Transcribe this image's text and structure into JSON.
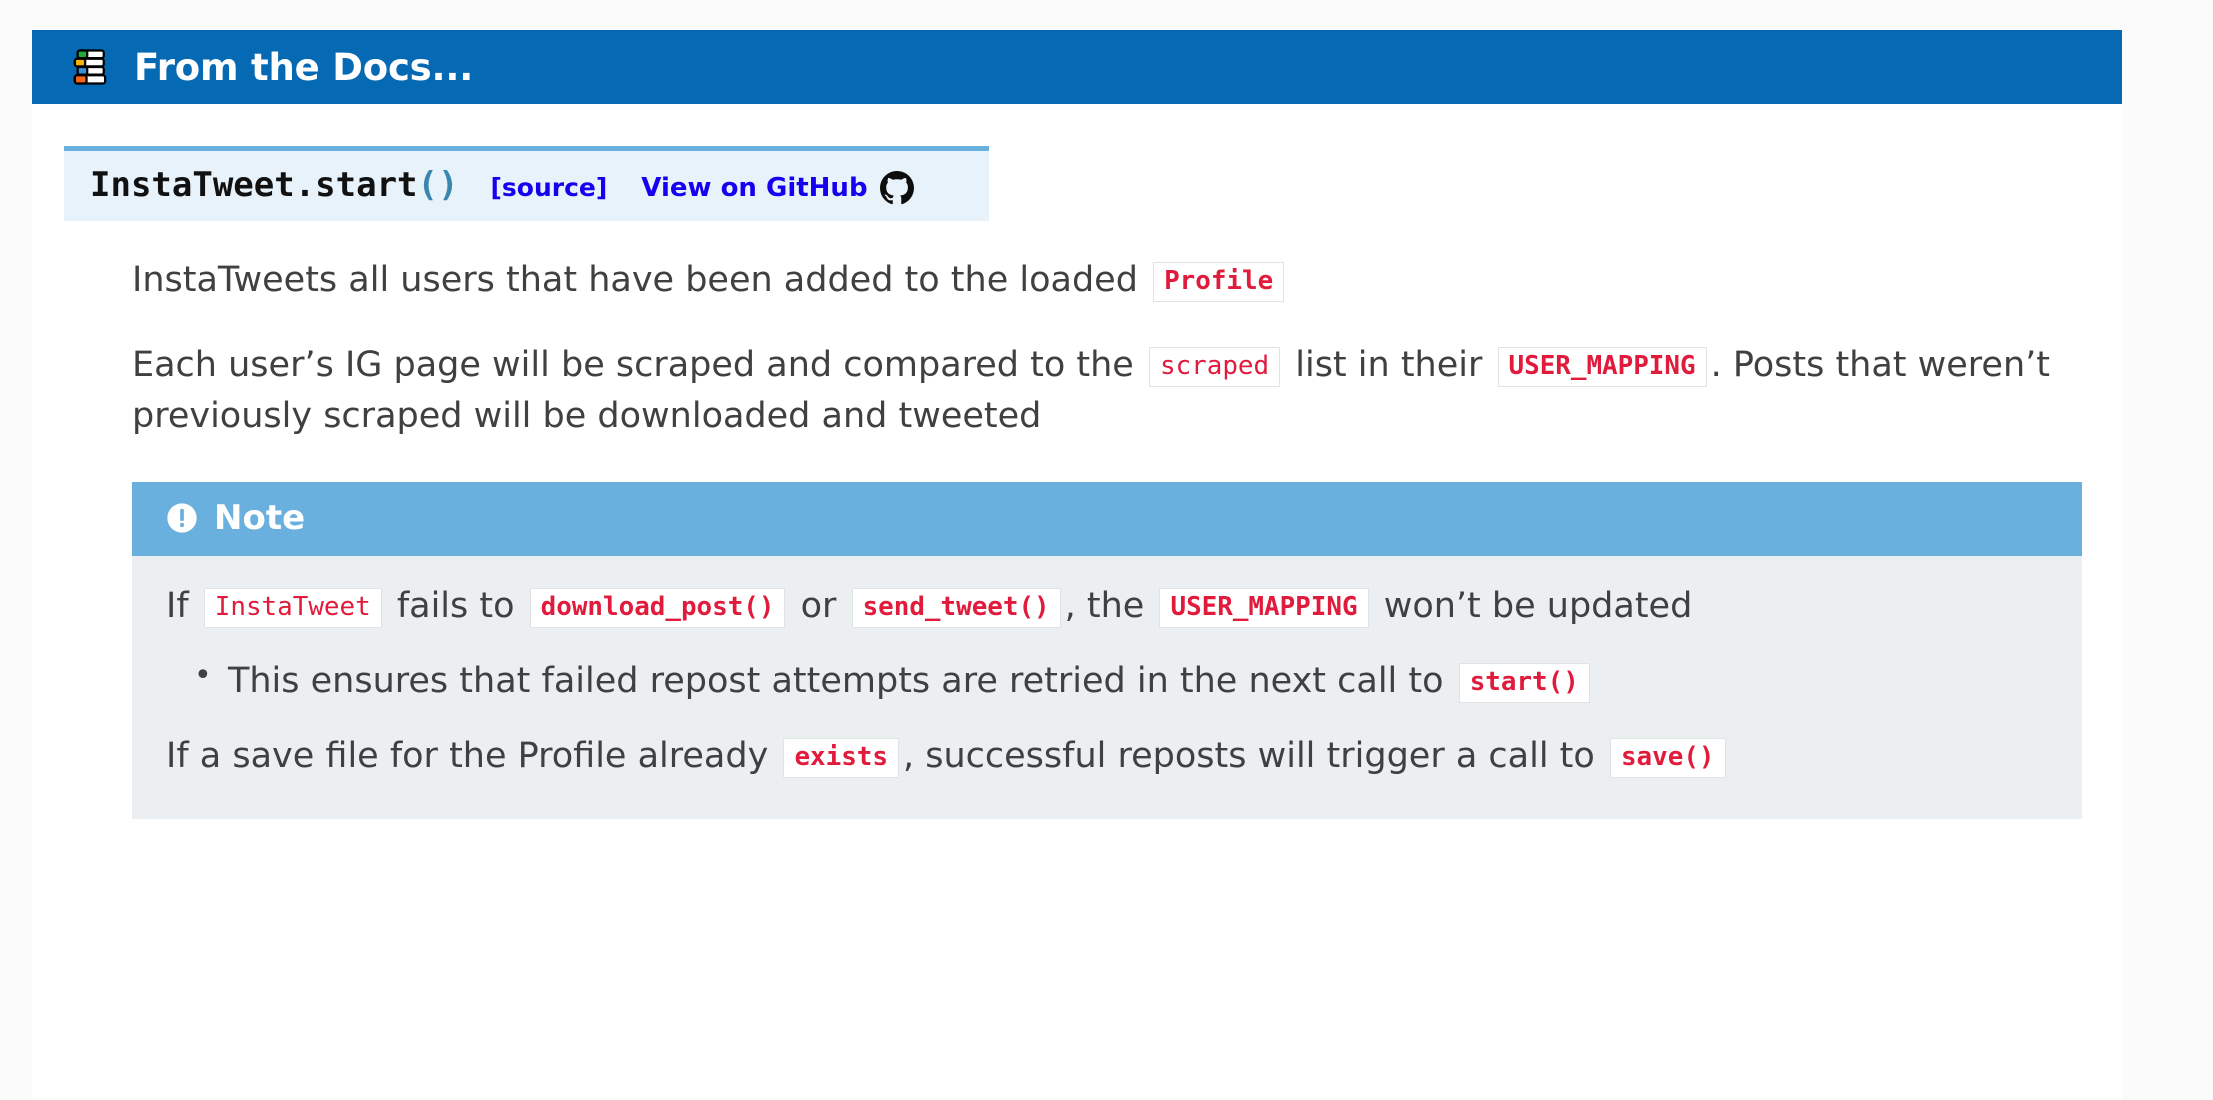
{
  "header": {
    "icon": "books-icon",
    "title": "From the Docs...",
    "background": "#0669b3"
  },
  "signature": {
    "name": "InstaTweet.start",
    "parens": "()",
    "source_label": "[source]",
    "github_label": "View on GitHub",
    "github_icon": "github-mark-icon",
    "accent_border": "#6ab0de",
    "background": "#e7f2fa",
    "link_color": "#1500ef"
  },
  "paragraphs": {
    "p1": {
      "seg1": "InstaTweets all users that have been added to the loaded",
      "code1": "Profile"
    },
    "p2": {
      "seg1": "Each user’s IG page will be scraped and compared to the",
      "code1": "scraped",
      "seg2": "list in their",
      "code2": "USER_MAPPING",
      "seg3": ".",
      "seg4": "Posts that weren’t previously scraped will be downloaded and tweeted"
    }
  },
  "note": {
    "icon": "exclamation-circle-icon",
    "title": "Note",
    "title_background": "#6ab0de",
    "body_background": "#eceff1",
    "line1": {
      "seg1": "If",
      "code1": "InstaTweet",
      "seg2": "fails to",
      "code2": "download_post()",
      "seg3": "or",
      "code3": "send_tweet()",
      "seg4": ", the",
      "code4": "USER_MAPPING",
      "seg5": "won’t be updated"
    },
    "bullet1": {
      "seg1": "This ensures that failed repost attempts are retried in the next call to",
      "code1": "start()"
    },
    "line2": {
      "seg1": "If a save file for the Profile already",
      "code1": "exists",
      "seg2": ", successful reposts will trigger a call to",
      "code2": "save()"
    }
  },
  "colors": {
    "code_literal": "#e01b3c",
    "body_text": "#404040",
    "page_background": "#fbfbfb"
  }
}
